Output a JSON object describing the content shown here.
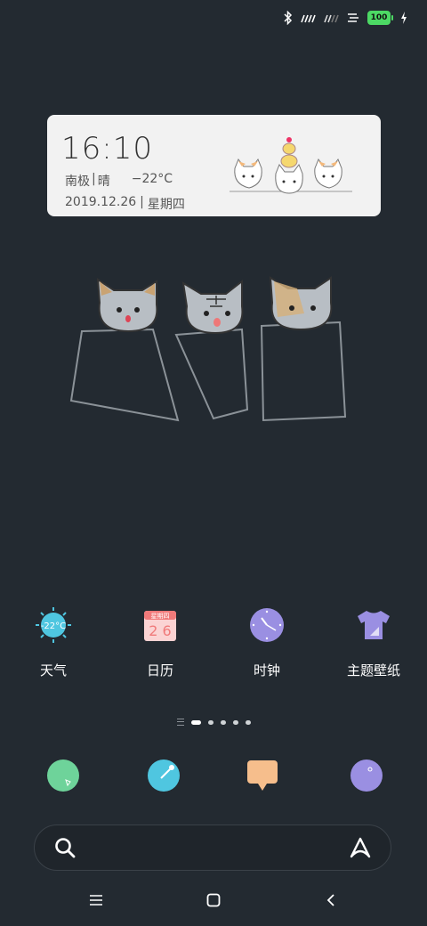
{
  "status_bar": {
    "battery_level": "100",
    "icons": [
      "bluetooth-icon",
      "signal-1-icon",
      "signal-2-icon",
      "data-saver-icon",
      "battery-icon",
      "charging-icon"
    ]
  },
  "clock_widget": {
    "time": "16:10",
    "location": "南极",
    "separator": "|",
    "condition": "晴",
    "temperature": "−22°C",
    "date": "2019.12.26",
    "weekday": "星期四"
  },
  "apps": [
    {
      "label": "天气",
      "icon": "weather-icon",
      "icon_text": "-22°C",
      "color": "#4fc6e0"
    },
    {
      "label": "日历",
      "icon": "calendar-icon",
      "icon_header": "星期四",
      "icon_text": "2 6",
      "color": "#f07a7a"
    },
    {
      "label": "时钟",
      "icon": "clock-icon",
      "color": "#9a8fe2"
    },
    {
      "label": "主题壁纸",
      "icon": "theme-icon",
      "color": "#9a8fe2"
    }
  ],
  "page_indicator": {
    "pages": 5,
    "active": 0
  },
  "dock": [
    {
      "icon": "phone-icon",
      "color": "#6ed39a"
    },
    {
      "icon": "browser-icon",
      "color": "#4fc6e0"
    },
    {
      "icon": "messages-icon",
      "color": "#f6be8c"
    },
    {
      "icon": "camera-icon",
      "color": "#9a8fe2"
    }
  ],
  "search_bar": {
    "icons": [
      "search-icon",
      "assistant-icon"
    ]
  },
  "nav_bar": {
    "icons": [
      "menu-icon",
      "home-icon",
      "back-icon"
    ]
  },
  "colors": {
    "background": "#232a31",
    "widget_bg": "#f2f2f2",
    "battery": "#4cd964"
  }
}
